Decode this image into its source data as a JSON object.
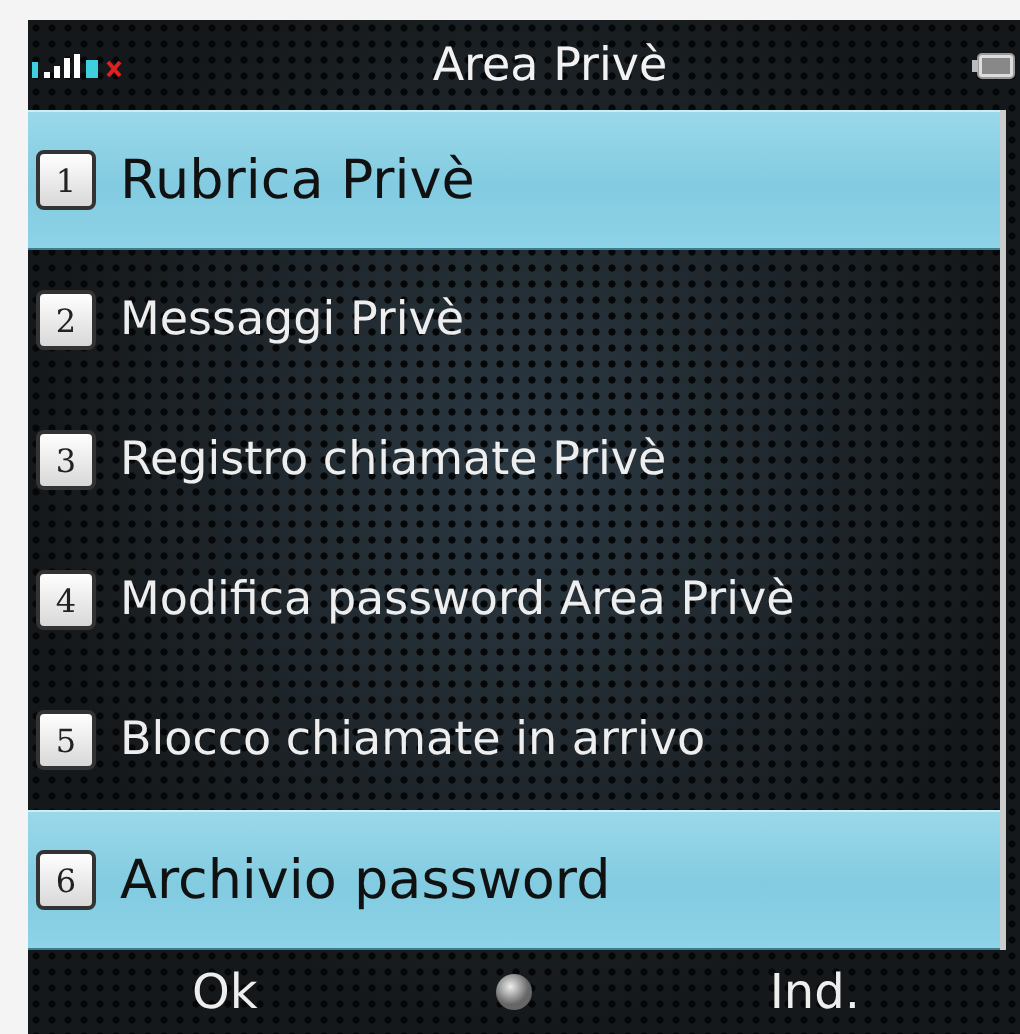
{
  "status_bar": {
    "title": "Area Privè"
  },
  "menu": [
    {
      "number": "1",
      "label": "Rubrica Privè",
      "selected": true
    },
    {
      "number": "2",
      "label": "Messaggi Privè",
      "selected": false
    },
    {
      "number": "3",
      "label": "Registro chiamate Privè",
      "selected": false
    },
    {
      "number": "4",
      "label": "Modifica password Area Privè",
      "selected": false
    },
    {
      "number": "5",
      "label": "Blocco chiamate in arrivo",
      "selected": false
    },
    {
      "number": "6",
      "label": "Archivio password",
      "selected": true
    }
  ],
  "softkeys": {
    "left": "Ok",
    "right": "Ind."
  }
}
